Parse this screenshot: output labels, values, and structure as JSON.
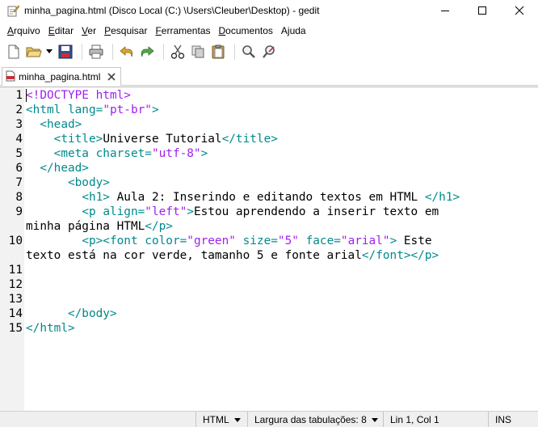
{
  "window": {
    "title": "minha_pagina.html (Disco Local (C:) \\Users\\Cleuber\\Desktop) - gedit",
    "icon": "text-editor-icon",
    "controls": [
      "minimize-icon",
      "maximize-icon",
      "close-icon"
    ]
  },
  "menu": [
    {
      "label": "Arquivo",
      "mnemonic": "A",
      "rest": "rquivo"
    },
    {
      "label": "Editar",
      "mnemonic": "E",
      "rest": "ditar"
    },
    {
      "label": "Ver",
      "mnemonic": "V",
      "rest": "er"
    },
    {
      "label": "Pesquisar",
      "mnemonic": "P",
      "rest": "esquisar"
    },
    {
      "label": "Ferramentas",
      "mnemonic": "F",
      "rest": "erramentas"
    },
    {
      "label": "Documentos",
      "mnemonic": "D",
      "rest": "ocumentos"
    },
    {
      "label": "Ajuda",
      "mnemonic": "j",
      "pre": "A",
      "rest": "uda"
    }
  ],
  "toolbar": [
    "new-document-icon",
    "open-folder-icon",
    "open-dropdown-icon",
    "save-icon",
    "print-icon",
    "undo-icon",
    "redo-icon",
    "cut-icon",
    "copy-icon",
    "paste-icon",
    "search-icon",
    "replace-icon"
  ],
  "tab": {
    "label": "minha_pagina.html",
    "icon": "html-file-icon",
    "close_icon": "close-icon"
  },
  "editor": {
    "line_numbers": [
      "1",
      "2",
      "3",
      "4",
      "5",
      "6",
      "7",
      "8",
      "9",
      "10",
      "11",
      "12",
      "13",
      "14",
      "15"
    ],
    "lines": [
      {
        "n": "1",
        "row": 0,
        "segments": [
          [
            "doctype",
            "<!DOCTYPE html>"
          ]
        ]
      },
      {
        "n": "2",
        "row": 1,
        "segments": [
          [
            "tag",
            "<html "
          ],
          [
            "attr",
            "lang="
          ],
          [
            "val",
            "\"pt-br\""
          ],
          [
            "tag",
            ">"
          ]
        ]
      },
      {
        "n": "3",
        "row": 2,
        "segments": [
          [
            "text",
            "  "
          ],
          [
            "tag",
            "<head>"
          ]
        ]
      },
      {
        "n": "4",
        "row": 3,
        "segments": [
          [
            "text",
            "    "
          ],
          [
            "tag",
            "<title>"
          ],
          [
            "text",
            "Universe Tutorial"
          ],
          [
            "tag",
            "</title>"
          ]
        ]
      },
      {
        "n": "5",
        "row": 4,
        "segments": [
          [
            "text",
            "    "
          ],
          [
            "tag",
            "<meta "
          ],
          [
            "attr",
            "charset="
          ],
          [
            "val",
            "\"utf-8\""
          ],
          [
            "tag",
            ">"
          ]
        ]
      },
      {
        "n": "6",
        "row": 5,
        "segments": [
          [
            "text",
            "  "
          ],
          [
            "tag",
            "</head>"
          ]
        ]
      },
      {
        "n": "7",
        "row": 6,
        "segments": [
          [
            "text",
            "      "
          ],
          [
            "tag",
            "<body>"
          ]
        ]
      },
      {
        "n": "8",
        "row": 7,
        "segments": [
          [
            "text",
            "        "
          ],
          [
            "tag",
            "<h1>"
          ],
          [
            "text",
            " Aula 2: Inserindo e editando textos em HTML "
          ],
          [
            "tag",
            "</h1>"
          ]
        ]
      },
      {
        "n": "9",
        "row": 8,
        "segments": [
          [
            "text",
            "        "
          ],
          [
            "tag",
            "<p "
          ],
          [
            "attr",
            "align="
          ],
          [
            "val",
            "\"left\""
          ],
          [
            "tag",
            ">"
          ],
          [
            "text",
            "Estou aprendendo a inserir texto em"
          ]
        ]
      },
      {
        "n": "",
        "row": 9,
        "segments": [
          [
            "text",
            "minha página HTML"
          ],
          [
            "tag",
            "</p>"
          ]
        ]
      },
      {
        "n": "10",
        "row": 10,
        "segments": [
          [
            "text",
            "        "
          ],
          [
            "tag",
            "<p><font "
          ],
          [
            "attr",
            "color="
          ],
          [
            "val",
            "\"green\""
          ],
          [
            "attr",
            " size="
          ],
          [
            "val",
            "\"5\""
          ],
          [
            "attr",
            " face="
          ],
          [
            "val",
            "\"arial\""
          ],
          [
            "tag",
            ">"
          ],
          [
            "text",
            " Este"
          ]
        ]
      },
      {
        "n": "",
        "row": 11,
        "segments": [
          [
            "text",
            "texto está na cor verde, tamanho 5 e fonte arial"
          ],
          [
            "tag",
            "</font></p>"
          ]
        ]
      },
      {
        "n": "11",
        "row": 12,
        "segments": []
      },
      {
        "n": "12",
        "row": 13,
        "segments": []
      },
      {
        "n": "13",
        "row": 14,
        "segments": []
      },
      {
        "n": "14",
        "row": 15,
        "segments": [
          [
            "text",
            "      "
          ],
          [
            "tag",
            "</body>"
          ]
        ]
      },
      {
        "n": "15",
        "row": 16,
        "segments": [
          [
            "tag",
            "</html>"
          ]
        ]
      }
    ]
  },
  "statusbar": {
    "language": "HTML",
    "tab_width": "Largura das tabulações: 8",
    "position": "Lin 1, Col 1",
    "mode": "INS"
  },
  "colors": {
    "tag": "#008a8c",
    "value": "#a020f0",
    "doctype": "#a020f0"
  }
}
